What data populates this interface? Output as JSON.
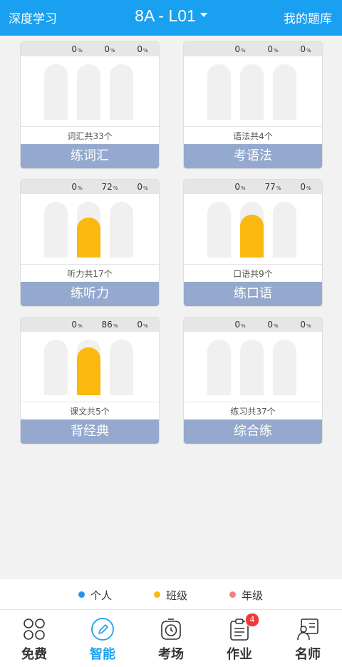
{
  "header": {
    "left": "深度学习",
    "title": "8A - L01",
    "right": "我的题库"
  },
  "cards": [
    {
      "pct": [
        "0",
        "0",
        "0"
      ],
      "unit": "%",
      "class_level": 0,
      "count": "词汇共33个",
      "action": "练词汇"
    },
    {
      "pct": [
        "0",
        "0",
        "0"
      ],
      "unit": "%",
      "class_level": 0,
      "count": "语法共4个",
      "action": "考语法"
    },
    {
      "pct": [
        "0",
        "72",
        "0"
      ],
      "unit": "%",
      "class_level": 0.72,
      "count": "听力共17个",
      "action": "练听力"
    },
    {
      "pct": [
        "0",
        "77",
        "0"
      ],
      "unit": "%",
      "class_level": 0.77,
      "count": "口语共9个",
      "action": "练口语"
    },
    {
      "pct": [
        "0",
        "86",
        "0"
      ],
      "unit": "%",
      "class_level": 0.86,
      "count": "课文共5个",
      "action": "背经典"
    },
    {
      "pct": [
        "0",
        "0",
        "0"
      ],
      "unit": "%",
      "class_level": 0,
      "count": "练习共37个",
      "action": "综合练"
    }
  ],
  "legend": [
    {
      "label": "个人",
      "color": "#2196f3"
    },
    {
      "label": "班级",
      "color": "#fbb80f"
    },
    {
      "label": "年级",
      "color": "#f08080"
    }
  ],
  "tabs": [
    {
      "label": "免费",
      "icon": "four-leaf-icon"
    },
    {
      "label": "智能",
      "icon": "pencil-circle-icon",
      "active": true
    },
    {
      "label": "考场",
      "icon": "stopwatch-icon"
    },
    {
      "label": "作业",
      "icon": "clipboard-icon",
      "badge": "4"
    },
    {
      "label": "名师",
      "icon": "teacher-board-icon"
    }
  ],
  "colors": {
    "primary": "#1aa0f0",
    "bar_fill": "#fbb80f",
    "card_button": "#94a9cd",
    "badge": "#f0393a"
  }
}
